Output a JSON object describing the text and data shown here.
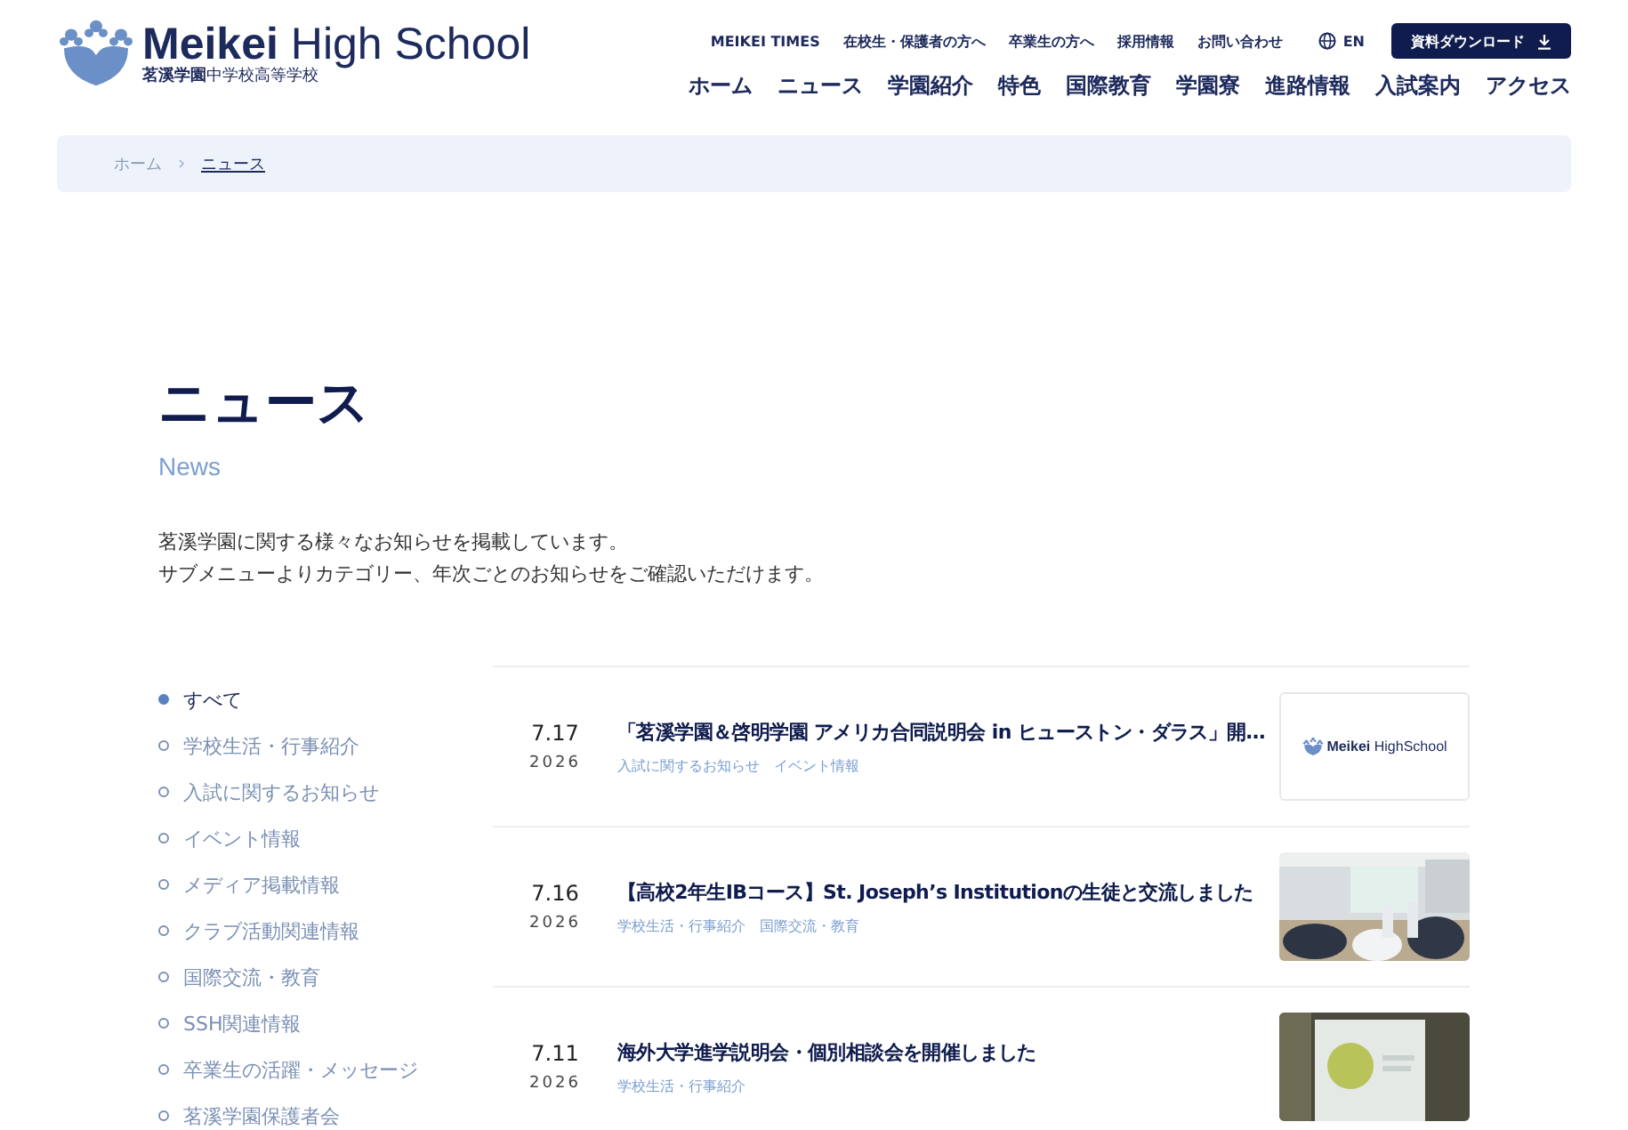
{
  "logo": {
    "name": "**Meikei** High School",
    "subtitle": "**茗溪学園**中学校高等学校"
  },
  "utility_nav": [
    {
      "label": "MEIKEI TIMES"
    },
    {
      "label": "在校生・保護者の方へ"
    },
    {
      "label": "卒業生の方へ"
    },
    {
      "label": "採用情報"
    },
    {
      "label": "お問い合わせ"
    }
  ],
  "language": {
    "label": "EN"
  },
  "download_button": {
    "label": "資料ダウンロード"
  },
  "main_nav": [
    {
      "label": "ホーム"
    },
    {
      "label": "ニュース"
    },
    {
      "label": "学園紹介"
    },
    {
      "label": "特色"
    },
    {
      "label": "国際教育"
    },
    {
      "label": "学園寮"
    },
    {
      "label": "進路情報"
    },
    {
      "label": "入試案内"
    },
    {
      "label": "アクセス"
    }
  ],
  "breadcrumb": [
    {
      "label": "ホーム",
      "current": false
    },
    {
      "label": "ニュース",
      "current": true
    }
  ],
  "page_title": "ニュース",
  "page_subtitle": "News",
  "intro": [
    "茗溪学園に関する様々なお知らせを掲載しています。",
    "サブメニューよりカテゴリー、年次ごとのお知らせをご確認いただけます。"
  ],
  "categories": [
    {
      "label": "すべて",
      "selected": true
    },
    {
      "label": "学校生活・行事紹介",
      "selected": false
    },
    {
      "label": "入試に関するお知らせ",
      "selected": false
    },
    {
      "label": "イベント情報",
      "selected": false
    },
    {
      "label": "メディア掲載情報",
      "selected": false
    },
    {
      "label": "クラブ活動関連情報",
      "selected": false
    },
    {
      "label": "国際交流・教育",
      "selected": false
    },
    {
      "label": "SSH関連情報",
      "selected": false
    },
    {
      "label": "卒業生の活躍・メッセージ",
      "selected": false
    },
    {
      "label": "茗溪学園保護者会",
      "selected": false
    }
  ],
  "news": [
    {
      "date": "7.17",
      "year": "2026",
      "title": "「茗溪学園＆啓明学園 アメリカ合同説明会 in ヒューストン・ダラス」開…",
      "tags": [
        "入試に関するお知らせ",
        "イベント情報"
      ],
      "thumb": {
        "kind": "logo",
        "text": "**Meikei** HighSchool"
      }
    },
    {
      "date": "7.16",
      "year": "2026",
      "title": "【高校2年生IBコース】St. Joseph’s Institutionの生徒と交流しました",
      "tags": [
        "学校生活・行事紹介",
        "国際交流・教育"
      ],
      "thumb": {
        "kind": "picture"
      }
    },
    {
      "date": "7.11",
      "year": "2026",
      "title": "海外大学進学説明会・個別相談会を開催しました",
      "tags": [
        "学校生活・行事紹介"
      ],
      "thumb": {
        "kind": "picture"
      }
    }
  ]
}
